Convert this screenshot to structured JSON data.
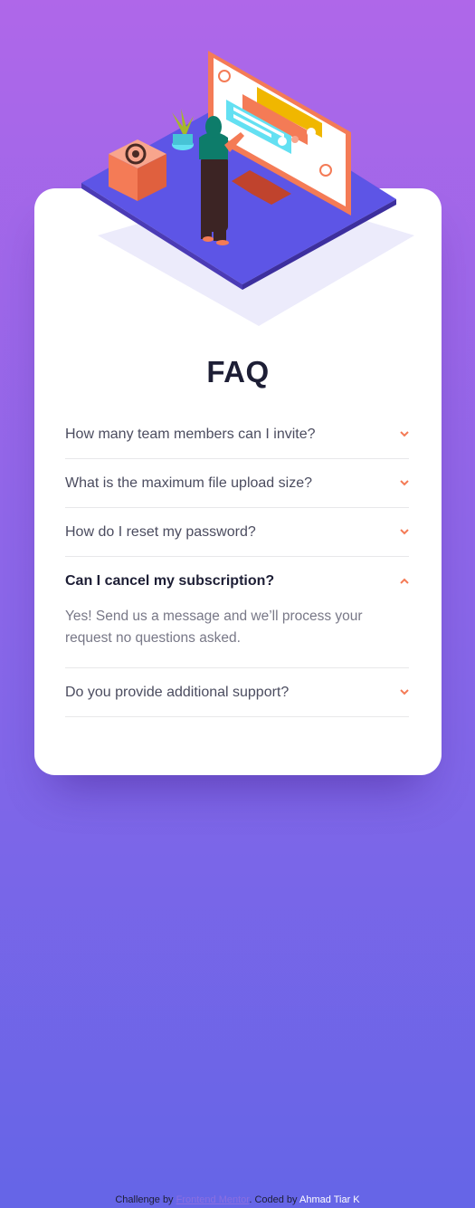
{
  "page": {
    "title": "FAQ"
  },
  "faq": [
    {
      "question": "How many team members can I invite?",
      "open": false
    },
    {
      "question": "What is the maximum file upload size?",
      "open": false
    },
    {
      "question": "How do I reset my password?",
      "open": false
    },
    {
      "question": "Can I cancel my subscription?",
      "open": true,
      "answer": "Yes! Send us a message and we’ll process your request no questions asked."
    },
    {
      "question": "Do you provide additional support?",
      "open": false
    }
  ],
  "footer": {
    "prefix": "Challenge by",
    "link_label": "Frontend Mentor",
    "middle": ". Coded by",
    "author": "Ahmad Tiar K"
  },
  "colors": {
    "background_top": "#af67e9",
    "background_bottom": "#6565e7",
    "accent": "#f47b56",
    "text_dark": "#1d1e35",
    "text_muted": "#787887"
  },
  "icons": {
    "collapsed": "chevron-down-icon",
    "expanded": "chevron-up-icon"
  }
}
